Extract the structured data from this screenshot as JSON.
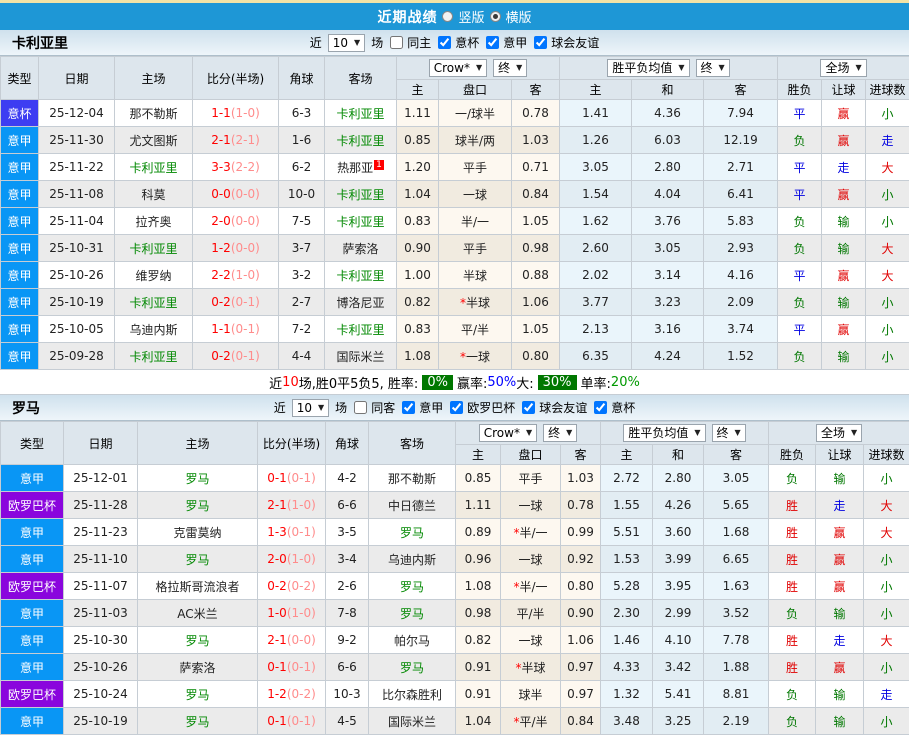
{
  "topbar": {
    "title": "近期战绩",
    "options": [
      {
        "label": "竖版",
        "selected": false
      },
      {
        "label": "横版",
        "selected": true
      }
    ],
    "accent_color": "#1e97d6"
  },
  "type_colors": {
    "league": "#0996f5",
    "cup": "#3d3df2",
    "euro": "#8a05dd"
  },
  "table_header": {
    "cols": [
      "类型",
      "日期",
      "主场",
      "比分(半场)",
      "角球",
      "客场"
    ],
    "dd_crown": "Crow*",
    "dd_final": "终",
    "dd_avg": "胜平负均值",
    "dd_full": "全场",
    "sub": [
      "主",
      "盘口",
      "客",
      "主",
      "和",
      "客",
      "胜负",
      "让球",
      "进球数"
    ]
  },
  "tables": [
    {
      "team": "卡利亚里",
      "filter": {
        "near": "近",
        "count": "10",
        "games_label": "场",
        "same": {
          "label": "同主",
          "checked": false
        },
        "comps": [
          {
            "label": "意杯",
            "checked": true
          },
          {
            "label": "意甲",
            "checked": true
          },
          {
            "label": "球会友谊",
            "checked": true
          }
        ]
      },
      "rows": [
        {
          "type": "意杯",
          "tc": "cup",
          "date": "25-12-04",
          "home": "那不勒斯",
          "th": false,
          "score": "1-1",
          "half": "(1-0)",
          "corner": "6-3",
          "away": "卡利亚里",
          "ta": true,
          "sup": "",
          "o1": "1.11",
          "hc": "一/球半",
          "star": false,
          "o2": "0.78",
          "a1": "1.41",
          "a2": "4.36",
          "a3": "7.94",
          "r1": "平",
          "c1": "blue",
          "r2": "赢",
          "c2": "red",
          "r3": "小",
          "c3": "green"
        },
        {
          "type": "意甲",
          "tc": "league",
          "date": "25-11-30",
          "home": "尤文图斯",
          "th": false,
          "score": "2-1",
          "half": "(2-1)",
          "corner": "1-6",
          "away": "卡利亚里",
          "ta": true,
          "sup": "",
          "o1": "0.85",
          "hc": "球半/两",
          "star": false,
          "o2": "1.03",
          "a1": "1.26",
          "a2": "6.03",
          "a3": "12.19",
          "r1": "负",
          "c1": "green",
          "r2": "赢",
          "c2": "red",
          "r3": "走",
          "c3": "blue"
        },
        {
          "type": "意甲",
          "tc": "league",
          "date": "25-11-22",
          "home": "卡利亚里",
          "th": true,
          "score": "3-3",
          "half": "(2-2)",
          "corner": "6-2",
          "away": "热那亚",
          "ta": false,
          "sup": "1",
          "o1": "1.20",
          "hc": "平手",
          "star": false,
          "o2": "0.71",
          "a1": "3.05",
          "a2": "2.80",
          "a3": "2.71",
          "r1": "平",
          "c1": "blue",
          "r2": "走",
          "c2": "blue",
          "r3": "大",
          "c3": "red"
        },
        {
          "type": "意甲",
          "tc": "league",
          "date": "25-11-08",
          "home": "科莫",
          "th": false,
          "score": "0-0",
          "half": "(0-0)",
          "corner": "10-0",
          "away": "卡利亚里",
          "ta": true,
          "sup": "",
          "o1": "1.04",
          "hc": "一球",
          "star": false,
          "o2": "0.84",
          "a1": "1.54",
          "a2": "4.04",
          "a3": "6.41",
          "r1": "平",
          "c1": "blue",
          "r2": "赢",
          "c2": "red",
          "r3": "小",
          "c3": "green"
        },
        {
          "type": "意甲",
          "tc": "league",
          "date": "25-11-04",
          "home": "拉齐奥",
          "th": false,
          "score": "2-0",
          "half": "(0-0)",
          "corner": "7-5",
          "away": "卡利亚里",
          "ta": true,
          "sup": "",
          "o1": "0.83",
          "hc": "半/一",
          "star": false,
          "o2": "1.05",
          "a1": "1.62",
          "a2": "3.76",
          "a3": "5.83",
          "r1": "负",
          "c1": "green",
          "r2": "输",
          "c2": "green",
          "r3": "小",
          "c3": "green"
        },
        {
          "type": "意甲",
          "tc": "league",
          "date": "25-10-31",
          "home": "卡利亚里",
          "th": true,
          "score": "1-2",
          "half": "(0-0)",
          "corner": "3-7",
          "away": "萨索洛",
          "ta": false,
          "sup": "",
          "o1": "0.90",
          "hc": "平手",
          "star": false,
          "o2": "0.98",
          "a1": "2.60",
          "a2": "3.05",
          "a3": "2.93",
          "r1": "负",
          "c1": "green",
          "r2": "输",
          "c2": "green",
          "r3": "大",
          "c3": "red"
        },
        {
          "type": "意甲",
          "tc": "league",
          "date": "25-10-26",
          "home": "维罗纳",
          "th": false,
          "score": "2-2",
          "half": "(1-0)",
          "corner": "3-2",
          "away": "卡利亚里",
          "ta": true,
          "sup": "",
          "o1": "1.00",
          "hc": "半球",
          "star": false,
          "o2": "0.88",
          "a1": "2.02",
          "a2": "3.14",
          "a3": "4.16",
          "r1": "平",
          "c1": "blue",
          "r2": "赢",
          "c2": "red",
          "r3": "大",
          "c3": "red"
        },
        {
          "type": "意甲",
          "tc": "league",
          "date": "25-10-19",
          "home": "卡利亚里",
          "th": true,
          "score": "0-2",
          "half": "(0-1)",
          "corner": "2-7",
          "away": "博洛尼亚",
          "ta": false,
          "sup": "",
          "o1": "0.82",
          "hc": "半球",
          "star": true,
          "o2": "1.06",
          "a1": "3.77",
          "a2": "3.23",
          "a3": "2.09",
          "r1": "负",
          "c1": "green",
          "r2": "输",
          "c2": "green",
          "r3": "小",
          "c3": "green"
        },
        {
          "type": "意甲",
          "tc": "league",
          "date": "25-10-05",
          "home": "乌迪内斯",
          "th": false,
          "score": "1-1",
          "half": "(0-1)",
          "corner": "7-2",
          "away": "卡利亚里",
          "ta": true,
          "sup": "",
          "o1": "0.83",
          "hc": "平/半",
          "star": false,
          "o2": "1.05",
          "a1": "2.13",
          "a2": "3.16",
          "a3": "3.74",
          "r1": "平",
          "c1": "blue",
          "r2": "赢",
          "c2": "red",
          "r3": "小",
          "c3": "green"
        },
        {
          "type": "意甲",
          "tc": "league",
          "date": "25-09-28",
          "home": "卡利亚里",
          "th": true,
          "score": "0-2",
          "half": "(0-1)",
          "corner": "4-4",
          "away": "国际米兰",
          "ta": false,
          "sup": "",
          "o1": "1.08",
          "hc": "一球",
          "star": true,
          "o2": "0.80",
          "a1": "6.35",
          "a2": "4.24",
          "a3": "1.52",
          "r1": "负",
          "c1": "green",
          "r2": "输",
          "c2": "green",
          "r3": "小",
          "c3": "green"
        }
      ],
      "summary": {
        "parts": [
          {
            "text": "近",
            "style": "plain"
          },
          {
            "text": "10",
            "style": "red"
          },
          {
            "text": "场,胜0平5负5, 胜率:",
            "style": "plain"
          },
          {
            "text": "0%",
            "style": "badge"
          },
          {
            "text": "赢率:",
            "style": "plain"
          },
          {
            "text": "50%",
            "style": "blue"
          },
          {
            "text": " 大:",
            "style": "plain"
          },
          {
            "text": "30%",
            "style": "badge"
          },
          {
            "text": "单率:",
            "style": "plain"
          },
          {
            "text": "20%",
            "style": "green"
          }
        ]
      }
    },
    {
      "team": "罗马",
      "filter": {
        "near": "近",
        "count": "10",
        "games_label": "场",
        "same": {
          "label": "同客",
          "checked": false
        },
        "comps": [
          {
            "label": "意甲",
            "checked": true
          },
          {
            "label": "欧罗巴杯",
            "checked": true
          },
          {
            "label": "球会友谊",
            "checked": true
          },
          {
            "label": "意杯",
            "checked": true
          }
        ]
      },
      "rows": [
        {
          "type": "意甲",
          "tc": "league",
          "date": "25-12-01",
          "home": "罗马",
          "th": true,
          "score": "0-1",
          "half": "(0-1)",
          "corner": "4-2",
          "away": "那不勒斯",
          "ta": false,
          "sup": "",
          "o1": "0.85",
          "hc": "平手",
          "star": false,
          "o2": "1.03",
          "a1": "2.72",
          "a2": "2.80",
          "a3": "3.05",
          "r1": "负",
          "c1": "green",
          "r2": "输",
          "c2": "green",
          "r3": "小",
          "c3": "green"
        },
        {
          "type": "欧罗巴杯",
          "tc": "euro",
          "date": "25-11-28",
          "home": "罗马",
          "th": true,
          "score": "2-1",
          "half": "(1-0)",
          "corner": "6-6",
          "away": "中日德兰",
          "ta": false,
          "sup": "",
          "o1": "1.11",
          "hc": "一球",
          "star": false,
          "o2": "0.78",
          "a1": "1.55",
          "a2": "4.26",
          "a3": "5.65",
          "r1": "胜",
          "c1": "red",
          "r2": "走",
          "c2": "blue",
          "r3": "大",
          "c3": "red"
        },
        {
          "type": "意甲",
          "tc": "league",
          "date": "25-11-23",
          "home": "克雷莫纳",
          "th": false,
          "score": "1-3",
          "half": "(0-1)",
          "corner": "3-5",
          "away": "罗马",
          "ta": true,
          "sup": "",
          "o1": "0.89",
          "hc": "半/一",
          "star": true,
          "o2": "0.99",
          "a1": "5.51",
          "a2": "3.60",
          "a3": "1.68",
          "r1": "胜",
          "c1": "red",
          "r2": "赢",
          "c2": "red",
          "r3": "大",
          "c3": "red"
        },
        {
          "type": "意甲",
          "tc": "league",
          "date": "25-11-10",
          "home": "罗马",
          "th": true,
          "score": "2-0",
          "half": "(1-0)",
          "corner": "3-4",
          "away": "乌迪内斯",
          "ta": false,
          "sup": "",
          "o1": "0.96",
          "hc": "一球",
          "star": false,
          "o2": "0.92",
          "a1": "1.53",
          "a2": "3.99",
          "a3": "6.65",
          "r1": "胜",
          "c1": "red",
          "r2": "赢",
          "c2": "red",
          "r3": "小",
          "c3": "green"
        },
        {
          "type": "欧罗巴杯",
          "tc": "euro",
          "date": "25-11-07",
          "home": "格拉斯哥流浪者",
          "th": false,
          "score": "0-2",
          "half": "(0-2)",
          "corner": "2-6",
          "away": "罗马",
          "ta": true,
          "sup": "",
          "o1": "1.08",
          "hc": "半/一",
          "star": true,
          "o2": "0.80",
          "a1": "5.28",
          "a2": "3.95",
          "a3": "1.63",
          "r1": "胜",
          "c1": "red",
          "r2": "赢",
          "c2": "red",
          "r3": "小",
          "c3": "green"
        },
        {
          "type": "意甲",
          "tc": "league",
          "date": "25-11-03",
          "home": "AC米兰",
          "th": false,
          "score": "1-0",
          "half": "(1-0)",
          "corner": "7-8",
          "away": "罗马",
          "ta": true,
          "sup": "",
          "o1": "0.98",
          "hc": "平/半",
          "star": false,
          "o2": "0.90",
          "a1": "2.30",
          "a2": "2.99",
          "a3": "3.52",
          "r1": "负",
          "c1": "green",
          "r2": "输",
          "c2": "green",
          "r3": "小",
          "c3": "green"
        },
        {
          "type": "意甲",
          "tc": "league",
          "date": "25-10-30",
          "home": "罗马",
          "th": true,
          "score": "2-1",
          "half": "(0-0)",
          "corner": "9-2",
          "away": "帕尔马",
          "ta": false,
          "sup": "",
          "o1": "0.82",
          "hc": "一球",
          "star": false,
          "o2": "1.06",
          "a1": "1.46",
          "a2": "4.10",
          "a3": "7.78",
          "r1": "胜",
          "c1": "red",
          "r2": "走",
          "c2": "blue",
          "r3": "大",
          "c3": "red"
        },
        {
          "type": "意甲",
          "tc": "league",
          "date": "25-10-26",
          "home": "萨索洛",
          "th": false,
          "score": "0-1",
          "half": "(0-1)",
          "corner": "6-6",
          "away": "罗马",
          "ta": true,
          "sup": "",
          "o1": "0.91",
          "hc": "半球",
          "star": true,
          "o2": "0.97",
          "a1": "4.33",
          "a2": "3.42",
          "a3": "1.88",
          "r1": "胜",
          "c1": "red",
          "r2": "赢",
          "c2": "red",
          "r3": "小",
          "c3": "green"
        },
        {
          "type": "欧罗巴杯",
          "tc": "euro",
          "date": "25-10-24",
          "home": "罗马",
          "th": true,
          "score": "1-2",
          "half": "(0-2)",
          "corner": "10-3",
          "away": "比尔森胜利",
          "ta": false,
          "sup": "",
          "o1": "0.91",
          "hc": "球半",
          "star": false,
          "o2": "0.97",
          "a1": "1.32",
          "a2": "5.41",
          "a3": "8.81",
          "r1": "负",
          "c1": "green",
          "r2": "输",
          "c2": "green",
          "r3": "走",
          "c3": "blue"
        },
        {
          "type": "意甲",
          "tc": "league",
          "date": "25-10-19",
          "home": "罗马",
          "th": true,
          "score": "0-1",
          "half": "(0-1)",
          "corner": "4-5",
          "away": "国际米兰",
          "ta": false,
          "sup": "",
          "o1": "1.04",
          "hc": "平/半",
          "star": true,
          "o2": "0.84",
          "a1": "3.48",
          "a2": "3.25",
          "a3": "2.19",
          "r1": "负",
          "c1": "green",
          "r2": "输",
          "c2": "green",
          "r3": "小",
          "c3": "green"
        }
      ],
      "summary": null
    }
  ]
}
